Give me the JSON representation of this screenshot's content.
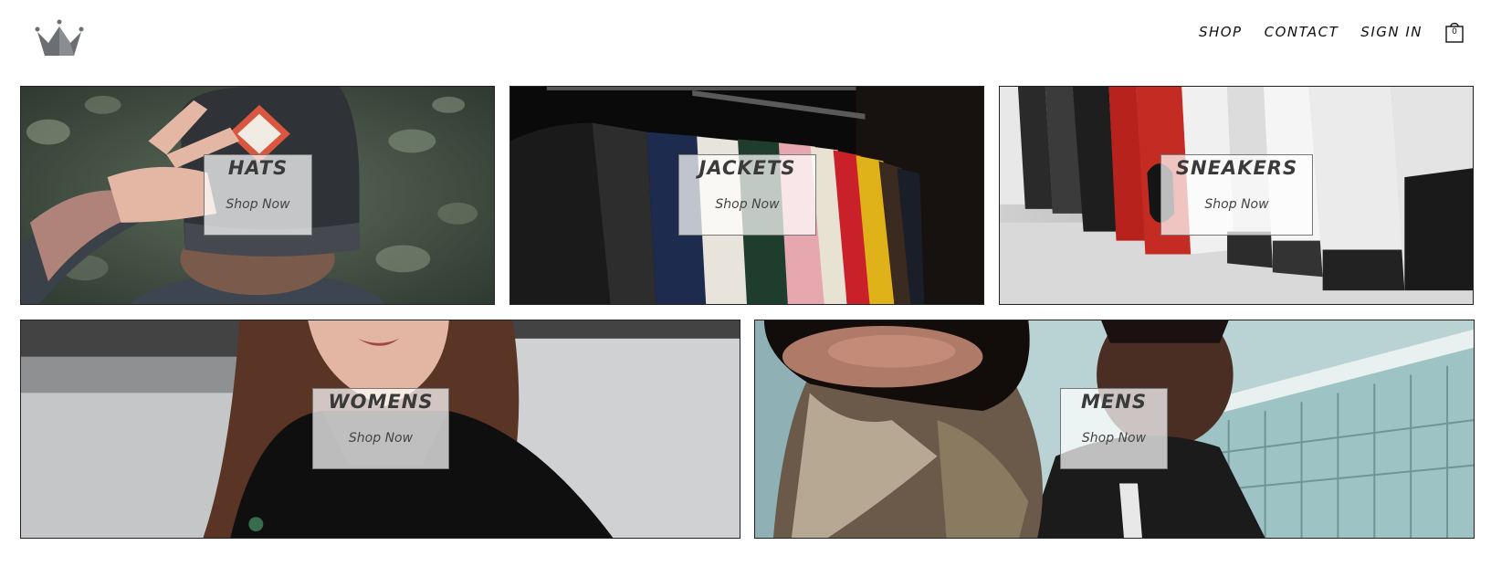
{
  "header": {
    "logo_icon": "crown-icon",
    "nav": {
      "shop_label": "SHOP",
      "contact_label": "CONTACT",
      "sign_in_label": "SIGN IN"
    },
    "cart": {
      "icon": "shopping-bag-icon",
      "count": "0"
    }
  },
  "categories": [
    {
      "title": "HATS",
      "cta": "Shop Now",
      "image": "man-holding-cap-photo"
    },
    {
      "title": "JACKETS",
      "cta": "Shop Now",
      "image": "jackets-on-rack-photo"
    },
    {
      "title": "SNEAKERS",
      "cta": "Shop Now",
      "image": "sneakers-on-shelf-photo"
    },
    {
      "title": "WOMENS",
      "cta": "Shop Now",
      "image": "woman-in-black-hoodie-photo"
    },
    {
      "title": "MENS",
      "cta": "Shop Now",
      "image": "man-reaching-toward-camera-photo"
    }
  ],
  "colors": {
    "text": "#111111",
    "label_background": "#ffffffb8",
    "label_text": "#3a3a3a",
    "logo": "#6b6f73"
  }
}
